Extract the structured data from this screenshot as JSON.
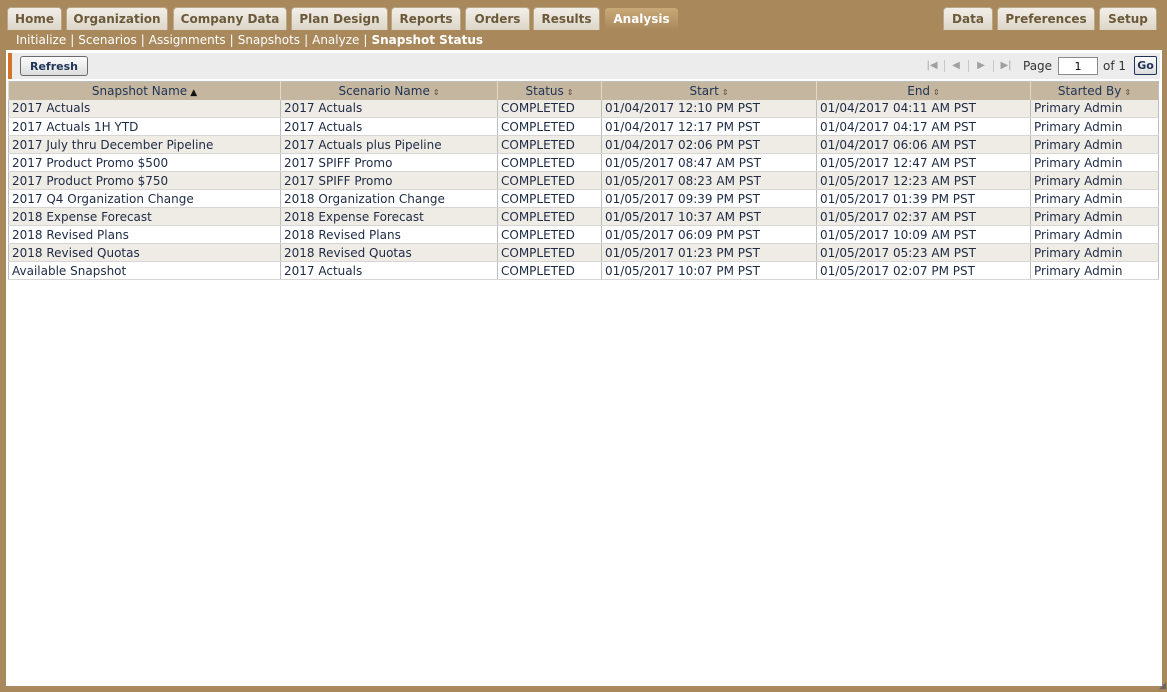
{
  "tabs_left": [
    "Home",
    "Organization",
    "Company Data",
    "Plan Design",
    "Reports",
    "Orders",
    "Results",
    "Analysis"
  ],
  "tabs_right": [
    "Data",
    "Preferences",
    "Setup"
  ],
  "active_tab": "Analysis",
  "subnav": {
    "links": [
      "Initialize",
      "Scenarios",
      "Assignments",
      "Snapshots",
      "Analyze"
    ],
    "current": "Snapshot Status",
    "separator": "|"
  },
  "toolbar": {
    "refresh_label": "Refresh",
    "page_label": "Page",
    "page_value": "1",
    "of_label": "of 1",
    "go_label": "Go"
  },
  "table": {
    "columns": [
      "Snapshot Name",
      "Scenario Name",
      "Status",
      "Start",
      "End",
      "Started By"
    ],
    "sorted_column": "Snapshot Name",
    "rows": [
      [
        "2017 Actuals",
        "2017 Actuals",
        "COMPLETED",
        "01/04/2017 12:10 PM PST",
        "01/04/2017 04:11 AM PST",
        "Primary Admin"
      ],
      [
        "2017 Actuals 1H YTD",
        "2017 Actuals",
        "COMPLETED",
        "01/04/2017 12:17 PM PST",
        "01/04/2017 04:17 AM PST",
        "Primary Admin"
      ],
      [
        "2017 July thru December Pipeline",
        "2017 Actuals plus Pipeline",
        "COMPLETED",
        "01/04/2017 02:06 PM PST",
        "01/04/2017 06:06 AM PST",
        "Primary Admin"
      ],
      [
        "2017 Product Promo $500",
        "2017 SPIFF Promo",
        "COMPLETED",
        "01/05/2017 08:47 AM PST",
        "01/05/2017 12:47 AM PST",
        "Primary Admin"
      ],
      [
        "2017 Product Promo $750",
        "2017 SPIFF Promo",
        "COMPLETED",
        "01/05/2017 08:23 AM PST",
        "01/05/2017 12:23 AM PST",
        "Primary Admin"
      ],
      [
        "2017 Q4 Organization Change",
        "2018 Organization Change",
        "COMPLETED",
        "01/05/2017 09:39 PM PST",
        "01/05/2017 01:39 PM PST",
        "Primary Admin"
      ],
      [
        "2018 Expense Forecast",
        "2018 Expense Forecast",
        "COMPLETED",
        "01/05/2017 10:37 AM PST",
        "01/05/2017 02:37 AM PST",
        "Primary Admin"
      ],
      [
        "2018 Revised Plans",
        "2018 Revised Plans",
        "COMPLETED",
        "01/05/2017 06:09 PM PST",
        "01/05/2017 10:09 AM PST",
        "Primary Admin"
      ],
      [
        "2018 Revised Quotas",
        "2018 Revised Quotas",
        "COMPLETED",
        "01/05/2017 01:23 PM PST",
        "01/05/2017 05:23 AM PST",
        "Primary Admin"
      ],
      [
        "Available Snapshot",
        "2017 Actuals",
        "COMPLETED",
        "01/05/2017 10:07 PM PST",
        "01/05/2017 02:07 PM PST",
        "Primary Admin"
      ]
    ]
  },
  "colors": {
    "frame": "#a9885c",
    "header_row": "#c5b69f",
    "accent": "#d4732a",
    "text_link": "#1f3457"
  }
}
